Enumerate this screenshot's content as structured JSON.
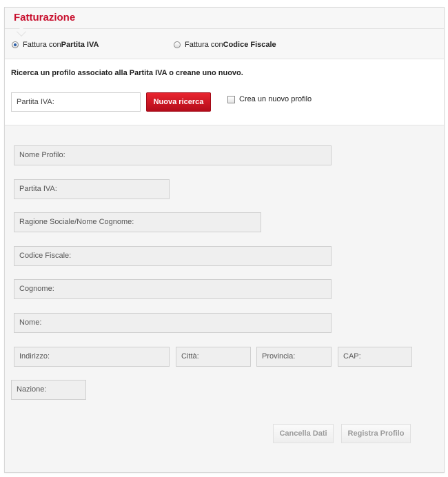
{
  "header": {
    "title": "Fatturazione"
  },
  "invoice_type": {
    "option_iva": {
      "prefix": "Fattura con ",
      "bold": "Partita IVA",
      "selected": true
    },
    "option_cf": {
      "prefix": "Fattura con ",
      "bold": "Codice Fiscale",
      "selected": false
    }
  },
  "search": {
    "hint": "Ricerca un profilo associato alla Partita IVA o creane uno nuovo.",
    "input_placeholder": "Partita IVA:",
    "button_label": "Nuova ricerca",
    "new_profile_label": "Crea un nuovo profilo",
    "new_profile_checked": false
  },
  "form": {
    "nome_profilo": "Nome Profilo:",
    "partita_iva": "Partita IVA:",
    "ragione_sociale": "Ragione Sociale/Nome Cognome:",
    "codice_fiscale": "Codice Fiscale:",
    "cognome": "Cognome:",
    "nome": "Nome:",
    "indirizzo": "Indirizzo:",
    "citta": "Città:",
    "provincia": "Provincia:",
    "cap": "CAP:",
    "nazione": "Nazione:"
  },
  "actions": {
    "cancel_label": "Cancella Dati",
    "register_label": "Registra Profilo"
  }
}
